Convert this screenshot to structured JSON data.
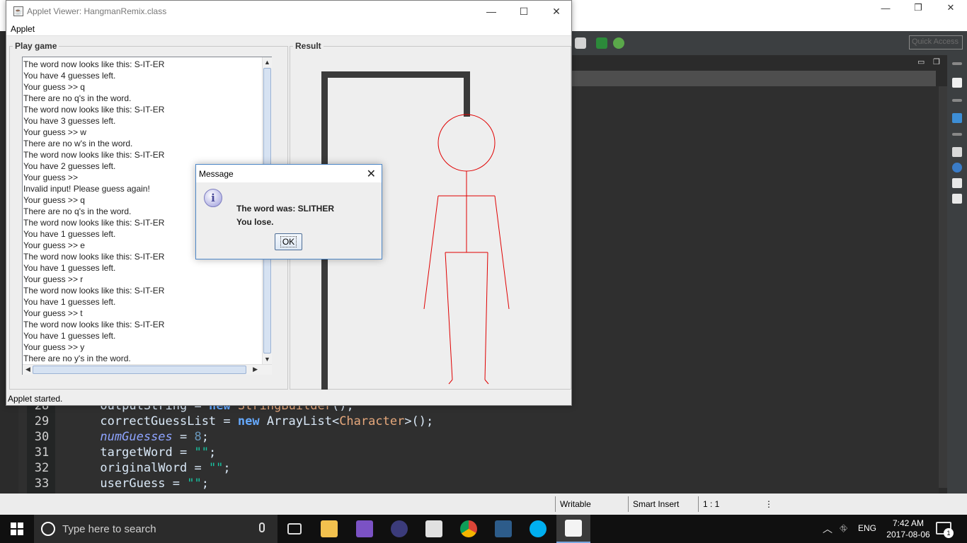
{
  "applet": {
    "title": "Applet Viewer: HangmanRemix.class",
    "menu": "Applet",
    "play_panel_title": "Play game",
    "result_panel_title": "Result",
    "status": "Applet started.",
    "log_lines": [
      "The word now looks like this: S-IT-ER",
      "You have 4 guesses left.",
      "Your guess >> q",
      "There are no q's in the word.",
      "The word now looks like this: S-IT-ER",
      "You have 3 guesses left.",
      "Your guess >> w",
      "There are no w's in the word.",
      "The word now looks like this: S-IT-ER",
      "You have 2 guesses left.",
      "Your guess >>",
      "Invalid input! Please guess again!",
      "Your guess >> q",
      "There are no q's in the word.",
      "The word now looks like this: S-IT-ER",
      "You have 1 guesses left.",
      "Your guess >> e",
      "The word now looks like this: S-IT-ER",
      "You have 1 guesses left.",
      "Your guess >> r",
      "The word now looks like this: S-IT-ER",
      "You have 1 guesses left.",
      "Your guess >> t",
      "The word now looks like this: S-IT-ER",
      "You have 1 guesses left.",
      "Your guess >> y",
      "There are no y's in the word."
    ],
    "hangman_color": "#e00000",
    "gallows_color": "#3a3a3a"
  },
  "dialog": {
    "title": "Message",
    "line1": "The word was: SLITHER",
    "line2": "You lose.",
    "ok_label": "OK"
  },
  "editor": {
    "lines": [
      {
        "num": "28",
        "text": "outputString = new StringBuilder();"
      },
      {
        "num": "29",
        "text": "correctGuessList = new ArrayList<Character>();"
      },
      {
        "num": "30",
        "text": "numGuesses = 8;"
      },
      {
        "num": "31",
        "text": "targetWord = \"\";"
      },
      {
        "num": "32",
        "text": "originalWord = \"\";"
      },
      {
        "num": "33",
        "text": "userGuess = \"\";"
      }
    ]
  },
  "eclipse": {
    "quick_access_placeholder": "Quick Access",
    "status_writable": "Writable",
    "status_insert": "Smart Insert",
    "status_position": "1 : 1"
  },
  "taskbar": {
    "search_placeholder": "Type here to search",
    "language": "ENG",
    "time": "7:42 AM",
    "date": "2017-08-06",
    "notification_count": "1"
  }
}
